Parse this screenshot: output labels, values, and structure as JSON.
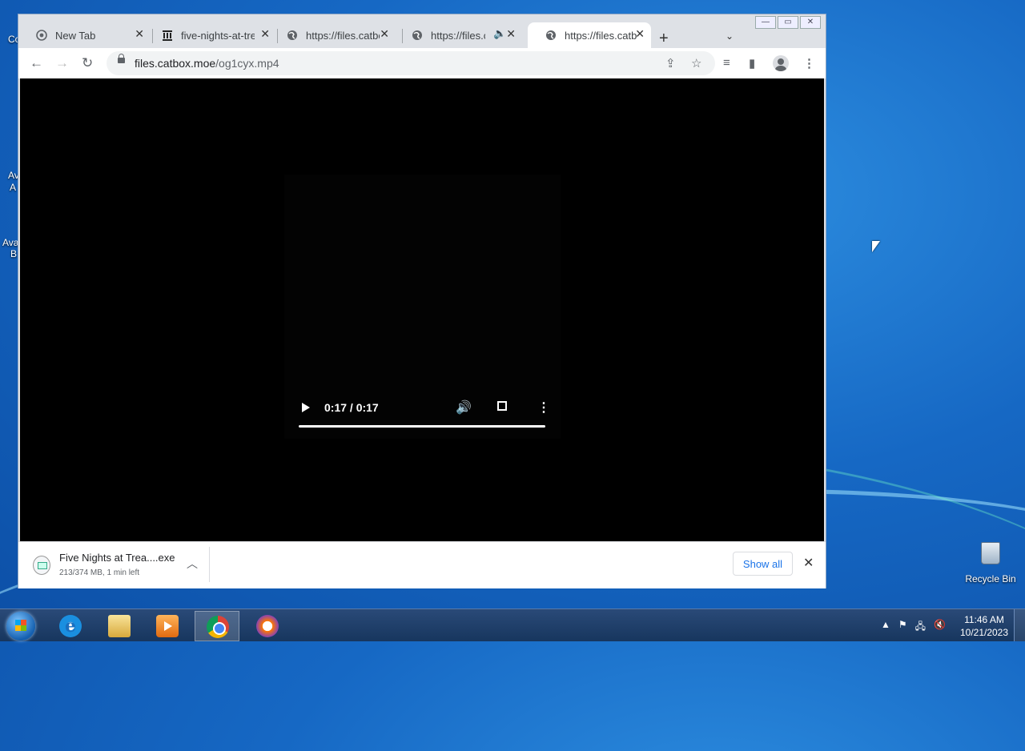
{
  "browser": {
    "tabs": [
      {
        "title": "New Tab",
        "favicon": "chrome-icon"
      },
      {
        "title": "five-nights-at-tre",
        "favicon": "museum-icon"
      },
      {
        "title": "https://files.catbo",
        "favicon": "globe-icon"
      },
      {
        "title": "https://files.c",
        "favicon": "globe-icon",
        "audio": true
      },
      {
        "title": "https://files.catbo",
        "favicon": "globe-icon",
        "active": true
      }
    ],
    "address": {
      "domain": "files.catbox.moe",
      "path": "/og1cyx.mp4"
    },
    "window_controls": {
      "minimize": "—",
      "maximize": "▭",
      "close": "✕"
    }
  },
  "video": {
    "time": "0:17 / 0:17",
    "progress": 1.0
  },
  "download_bar": {
    "filename": "Five Nights at Trea....exe",
    "status": "213/374 MB, 1 min left",
    "show_all_label": "Show all"
  },
  "desktop": {
    "recycle_bin_label": "Recycle Bin",
    "partial_labels": [
      "Co",
      "Av",
      "A",
      "Ava",
      "B"
    ]
  },
  "taskbar": {
    "apps": [
      "internet-explorer",
      "file-explorer",
      "media-player",
      "chrome",
      "avast-secure-browser"
    ],
    "active_app": "chrome",
    "clock_time": "11:46 AM",
    "clock_date": "10/21/2023"
  }
}
